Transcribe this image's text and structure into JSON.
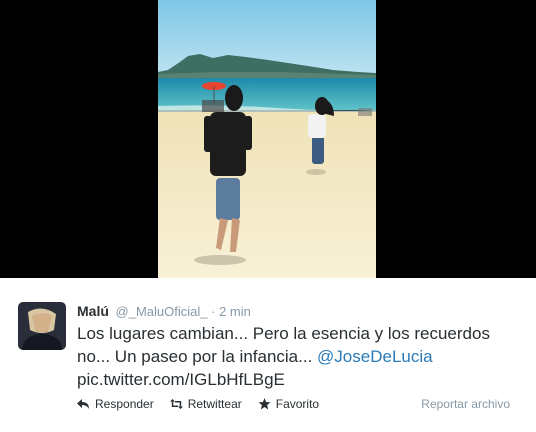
{
  "tweet": {
    "author_name": "Malú",
    "author_handle": "@_MaluOficial_",
    "separator": "·",
    "time": "2 min",
    "text_part1": "Los lugares cambian... Pero la esencia y los recuerdos no... Un paseo por la infancia... ",
    "mention": "@JoseDeLucia",
    "pic_link": "pic.twitter.com/IGLbHfLBgE"
  },
  "actions": {
    "reply_label": "Responder",
    "retweet_label": "Retwittear",
    "favorite_label": "Favorito",
    "report_label": "Reportar archivo"
  },
  "icons": {
    "reply": "reply-arrow-icon",
    "retweet": "retweet-icon",
    "favorite": "star-icon"
  },
  "colors": {
    "link": "#2b7bb9",
    "muted": "#8899a6",
    "text": "#292f33",
    "media_background": "#000000"
  }
}
